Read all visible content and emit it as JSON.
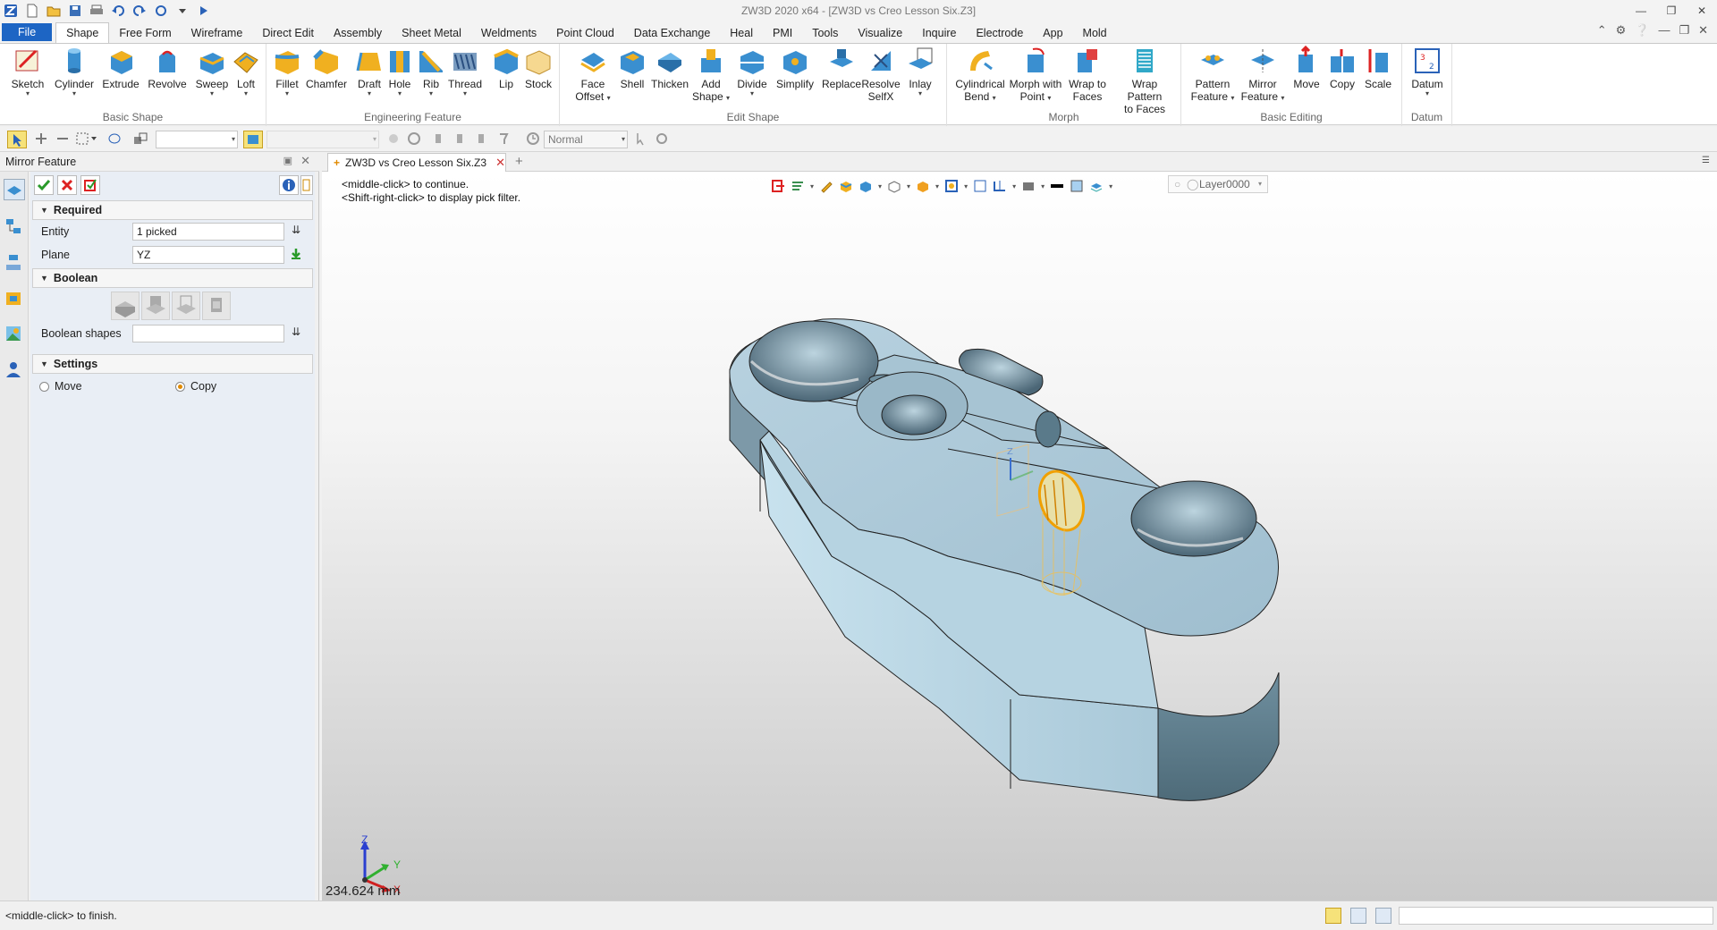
{
  "window": {
    "title": "ZW3D 2020 x64 - [ZW3D vs Creo Lesson Six.Z3]"
  },
  "ribbon_tabs": [
    {
      "label": "File"
    },
    {
      "label": "Shape"
    },
    {
      "label": "Free Form"
    },
    {
      "label": "Wireframe"
    },
    {
      "label": "Direct Edit"
    },
    {
      "label": "Assembly"
    },
    {
      "label": "Sheet Metal"
    },
    {
      "label": "Weldments"
    },
    {
      "label": "Point Cloud"
    },
    {
      "label": "Data Exchange"
    },
    {
      "label": "Heal"
    },
    {
      "label": "PMI"
    },
    {
      "label": "Tools"
    },
    {
      "label": "Visualize"
    },
    {
      "label": "Inquire"
    },
    {
      "label": "Electrode"
    },
    {
      "label": "App"
    },
    {
      "label": "Mold"
    }
  ],
  "ribbon_groups": {
    "basic_shape": {
      "title": "Basic Shape",
      "tools": [
        "Sketch",
        "Cylinder",
        "Extrude",
        "Revolve",
        "Sweep",
        "Loft"
      ]
    },
    "engineering": {
      "title": "Engineering Feature",
      "tools": [
        "Fillet",
        "Chamfer",
        "Draft",
        "Hole",
        "Rib",
        "Thread",
        "Lip",
        "Stock"
      ]
    },
    "edit_shape": {
      "title": "Edit Shape",
      "tools": [
        "Face Offset",
        "Shell",
        "Thicken",
        "Add Shape",
        "Divide",
        "Simplify",
        "Replace",
        "Resolve SelfX",
        "Inlay"
      ]
    },
    "morph": {
      "title": "Morph",
      "tools": [
        "Cylindrical Bend",
        "Morph with Point",
        "Wrap to Faces",
        "Wrap Pattern to Faces"
      ]
    },
    "basic_editing": {
      "title": "Basic Editing",
      "tools": [
        "Pattern Feature",
        "Mirror Feature",
        "Move",
        "Copy",
        "Scale"
      ]
    },
    "datum": {
      "title": "Datum",
      "tools": [
        "Datum"
      ]
    }
  },
  "tool_labels": {
    "sketch": "Sketch",
    "cylinder": "Cylinder",
    "extrude": "Extrude",
    "revolve": "Revolve",
    "sweep": "Sweep",
    "loft": "Loft",
    "fillet": "Fillet",
    "chamfer": "Chamfer",
    "draft": "Draft",
    "hole": "Hole",
    "rib": "Rib",
    "thread": "Thread",
    "lip": "Lip",
    "stock": "Stock",
    "face_offset_1": "Face",
    "face_offset_2": "Offset",
    "shell": "Shell",
    "thicken": "Thicken",
    "add_shape_1": "Add",
    "add_shape_2": "Shape",
    "divide": "Divide",
    "simplify": "Simplify",
    "replace": "Replace",
    "resolve_1": "Resolve",
    "resolve_2": "SelfX",
    "inlay": "Inlay",
    "cyl_bend_1": "Cylindrical",
    "cyl_bend_2": "Bend",
    "morph_pt_1": "Morph with",
    "morph_pt_2": "Point",
    "wrap_faces_1": "Wrap to",
    "wrap_faces_2": "Faces",
    "wrap_pattern_1": "Wrap Pattern",
    "wrap_pattern_2": "to Faces",
    "pattern_1": "Pattern",
    "pattern_2": "Feature",
    "mirror_1": "Mirror",
    "mirror_2": "Feature",
    "move": "Move",
    "copy": "Copy",
    "scale": "Scale",
    "datum": "Datum"
  },
  "toolbar2": {
    "render_mode": "Normal"
  },
  "left_panel": {
    "title": "Mirror Feature",
    "sections": {
      "required": {
        "title": "Required",
        "entity_label": "Entity",
        "entity_value": "1 picked",
        "plane_label": "Plane",
        "plane_value": "YZ"
      },
      "boolean": {
        "title": "Boolean",
        "shapes_label": "Boolean shapes",
        "shapes_value": ""
      },
      "settings": {
        "title": "Settings",
        "move_label": "Move",
        "copy_label": "Copy",
        "selected": "Copy"
      }
    }
  },
  "document_tab": {
    "label": "ZW3D vs Creo Lesson Six.Z3"
  },
  "viewport": {
    "hint_1": "<middle-click> to continue.",
    "hint_2": "<Shift-right-click> to display pick filter.",
    "layer": "Layer0000",
    "measure": "234.624 mm",
    "axis_x": "X",
    "axis_y": "Y",
    "axis_z": "Z",
    "colors": {
      "part_face": "#a9c6d6",
      "part_dark": "#6f8f9f",
      "highlight": "#f0a000",
      "bg_top": "#ffffff",
      "bg_bottom": "#c9c9c9"
    }
  },
  "statusbar": {
    "message": "<middle-click> to finish."
  }
}
